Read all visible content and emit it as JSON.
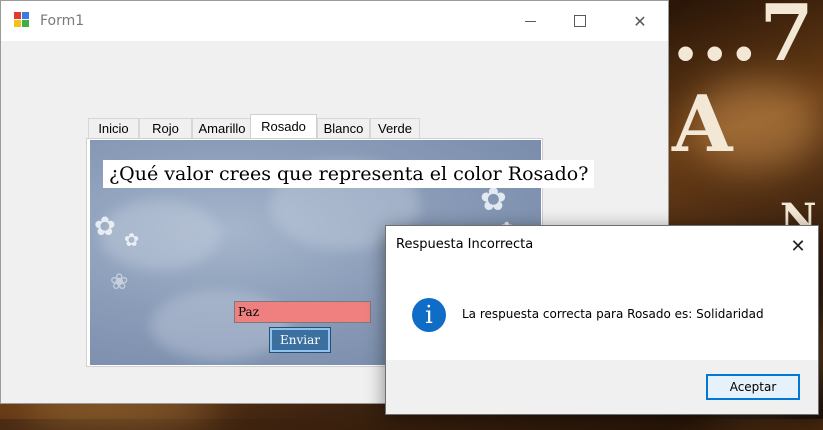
{
  "desktop": {
    "bg_text_top": "...7 A",
    "bg_text_mid": "N"
  },
  "window": {
    "title": "Form1",
    "close_glyph": "✕"
  },
  "tabs": [
    {
      "label": "Inicio",
      "active": false
    },
    {
      "label": "Rojo",
      "active": false
    },
    {
      "label": "Amarillo",
      "active": false
    },
    {
      "label": "Rosado",
      "active": true
    },
    {
      "label": "Blanco",
      "active": false
    },
    {
      "label": "Verde",
      "active": false
    }
  ],
  "panel": {
    "question": "¿Qué valor crees que representa el color Rosado?",
    "answer_value": "Paz",
    "send_label": "Enviar"
  },
  "dialog": {
    "title": "Respuesta Incorrecta",
    "message": "La respuesta correcta para Rosado es: Solidaridad",
    "ok_label": "Aceptar",
    "icon_glyph": "i",
    "close_glyph": "✕"
  },
  "colors": {
    "input_bg": "#f08080",
    "send_bg": "#3a6fa0",
    "info_icon": "#0f6cc7",
    "ok_border": "#0078d7"
  }
}
